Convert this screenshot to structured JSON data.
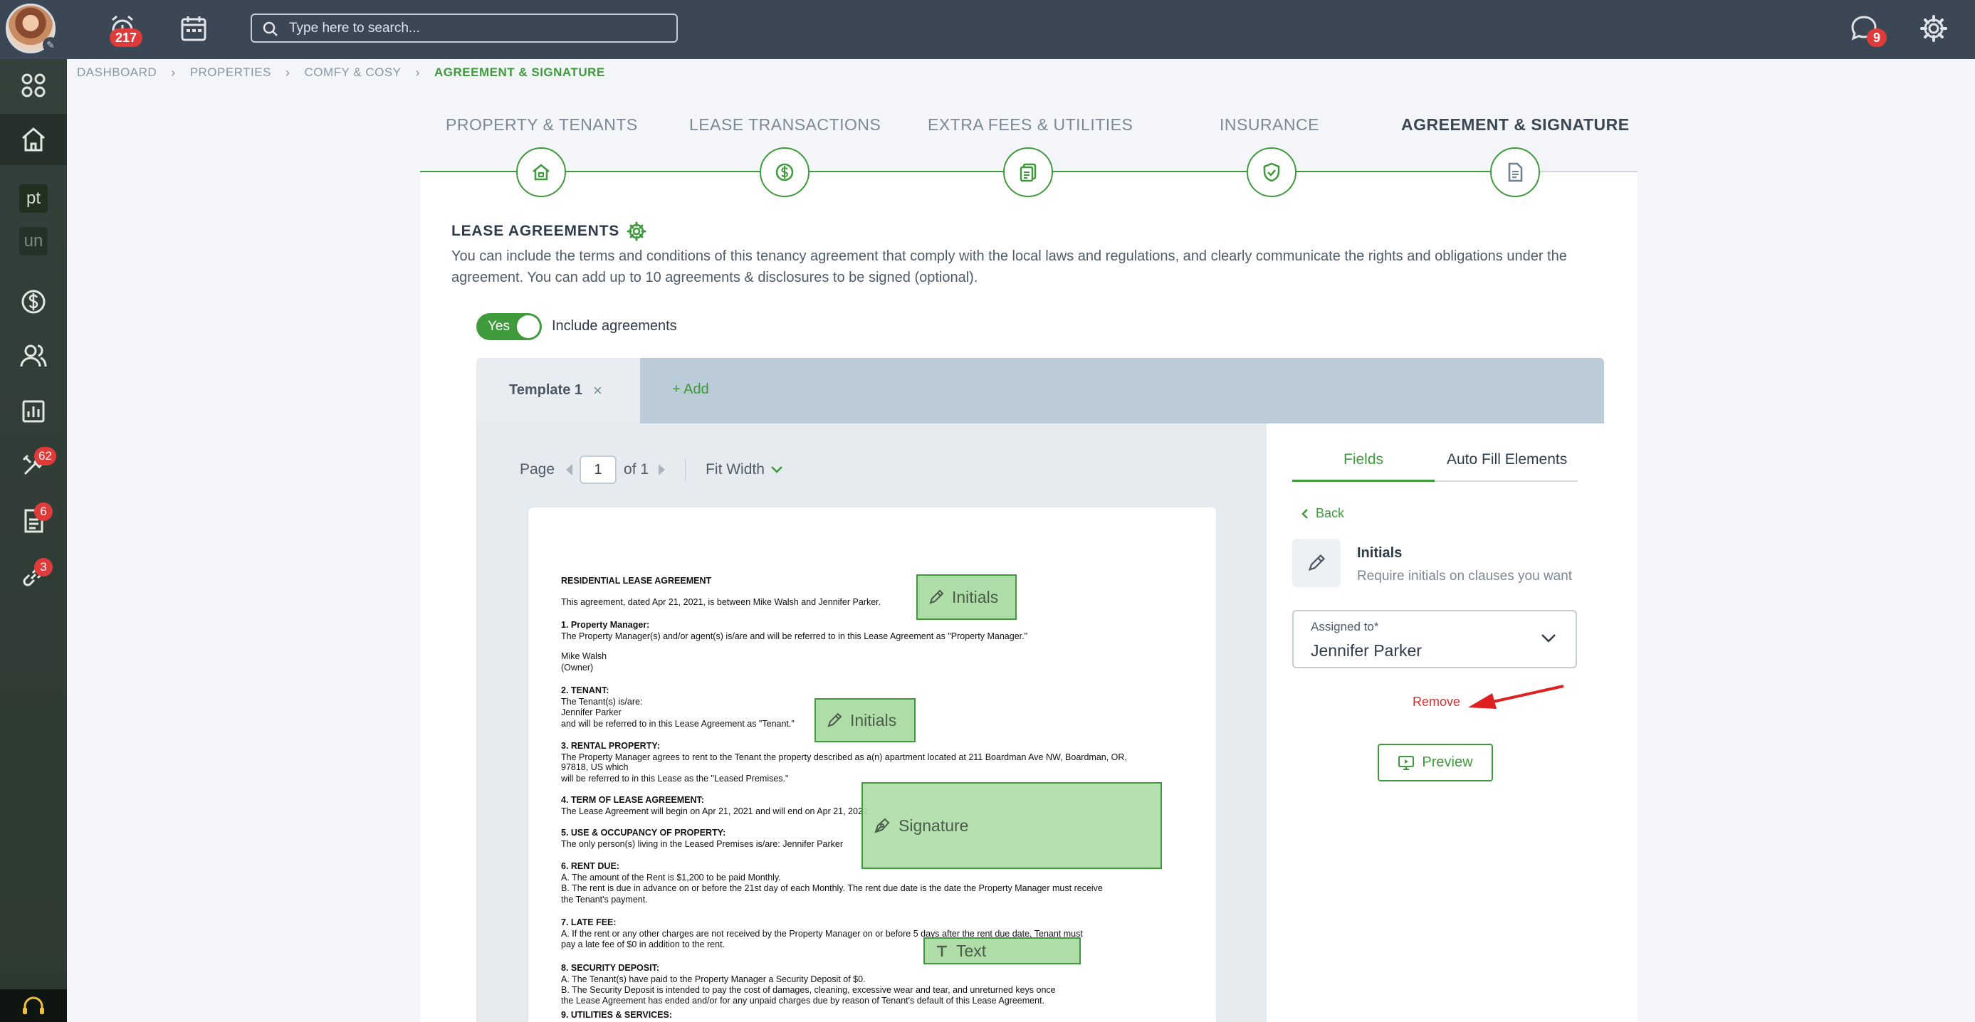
{
  "topbar": {
    "notifications_count": "217",
    "search_placeholder": "Type here to search...",
    "messages_count": "9"
  },
  "sidebar": {
    "items": [
      {
        "icon": "apps-grid-icon"
      },
      {
        "icon": "home-icon"
      },
      {
        "text": "pt"
      },
      {
        "text": "un"
      },
      {
        "icon": "dollar-circle-icon"
      },
      {
        "icon": "people-icon"
      },
      {
        "icon": "reports-chart-icon"
      },
      {
        "icon": "tools-icon",
        "badge": "62"
      },
      {
        "icon": "document-icon",
        "badge": "6"
      },
      {
        "icon": "link-icon",
        "badge": "3"
      }
    ]
  },
  "breadcrumb": [
    "DASHBOARD",
    "PROPERTIES",
    "COMFY & COSY",
    "AGREEMENT & SIGNATURE"
  ],
  "steps": [
    {
      "label": "PROPERTY & TENANTS",
      "icon": "home-icon"
    },
    {
      "label": "LEASE TRANSACTIONS",
      "icon": "dollar-icon"
    },
    {
      "label": "EXTRA FEES & UTILITIES",
      "icon": "bills-icon"
    },
    {
      "label": "INSURANCE",
      "icon": "shield-icon"
    },
    {
      "label": "AGREEMENT & SIGNATURE",
      "icon": "document-icon"
    }
  ],
  "section": {
    "title": "LEASE AGREEMENTS",
    "description": "You can include the terms and conditions of this tenancy agreement that comply with the local laws and regulations, and clearly communicate the rights and obligations under the agreement. You can add up to 10 agreements & disclosures to be signed (optional)."
  },
  "toggle": {
    "value": "Yes",
    "label": "Include agreements"
  },
  "templates": {
    "active": "Template 1",
    "close": "×",
    "add": "+ Add"
  },
  "viewer": {
    "page_label": "Page",
    "page_value": "1",
    "page_of": "of 1",
    "zoom": "Fit Width"
  },
  "document": {
    "lines": [
      {
        "text": "RESIDENTIAL LEASE AGREEMENT",
        "bold": true
      },
      {
        "text": "This agreement, dated Apr 21, 2021, is between Mike Walsh and Jennifer Parker.",
        "bold": false
      },
      {
        "text": "1. Property Manager:",
        "bold": true
      },
      {
        "text": "The Property Manager(s) and/or agent(s) is/are and will be referred to in this Lease Agreement as \"Property Manager.\"",
        "bold": false
      },
      {
        "text": "Mike Walsh",
        "bold": false
      },
      {
        "text": "(Owner)",
        "bold": false
      },
      {
        "text": "2. TENANT:",
        "bold": true
      },
      {
        "text": "The Tenant(s) is/are:",
        "bold": false
      },
      {
        "text": "Jennifer Parker",
        "bold": false
      },
      {
        "text": "and will be referred to in this Lease Agreement as \"Tenant.\"",
        "bold": false
      },
      {
        "text": "3. RENTAL PROPERTY:",
        "bold": true
      },
      {
        "text": "The Property Manager agrees to rent to the Tenant the property described as a(n) apartment located at  211 Boardman Ave NW, Boardman, OR,",
        "bold": false
      },
      {
        "text": "97818, US which",
        "bold": false
      },
      {
        "text": "will be referred to in this Lease as the \"Leased Premises.\"",
        "bold": false
      },
      {
        "text": "4. TERM OF LEASE AGREEMENT:",
        "bold": true
      },
      {
        "text": "The Lease Agreement will begin on Apr 21, 2021 and will end on Apr 21, 2022.",
        "bold": false
      },
      {
        "text": "5. USE & OCCUPANCY OF PROPERTY:",
        "bold": true
      },
      {
        "text": "The only person(s) living in the Leased Premises is/are: Jennifer Parker",
        "bold": false
      },
      {
        "text": "6. RENT DUE:",
        "bold": true
      },
      {
        "text": "A. The amount of the Rent is $1,200 to be paid Monthly.",
        "bold": false
      },
      {
        "text": "B. The rent is due in advance on or before the 21st day of each Monthly. The rent due date is the date the Property Manager must receive",
        "bold": false
      },
      {
        "text": "the Tenant's payment.",
        "bold": false
      },
      {
        "text": "7. LATE FEE:",
        "bold": true
      },
      {
        "text": "A. If the rent or any other charges are not received by the Property Manager on or before 5 days after the rent due date, Tenant must",
        "bold": false
      },
      {
        "text": "pay a late fee of $0 in addition to the rent.",
        "bold": false
      },
      {
        "text": "8. SECURITY DEPOSIT:",
        "bold": true
      },
      {
        "text": "A. The Tenant(s) have paid to the Property Manager a Security Deposit of $0.",
        "bold": false
      },
      {
        "text": "B. The Security Deposit is intended to pay the cost of damages, cleaning, excessive wear and tear, and unreturned keys once",
        "bold": false
      },
      {
        "text": "the Lease Agreement has ended and/or for any unpaid charges due by reason of Tenant's default of this Lease Agreement.",
        "bold": false
      },
      {
        "text": "9. UTILITIES & SERVICES:",
        "bold": true
      }
    ],
    "fields": [
      {
        "label": "Initials",
        "icon": "pencil-icon"
      },
      {
        "label": "Initials",
        "icon": "pencil-icon"
      },
      {
        "label": "Signature",
        "icon": "pen-nib-icon"
      },
      {
        "label": "Text",
        "icon": "text-icon"
      }
    ]
  },
  "panel": {
    "tabs": [
      "Fields",
      "Auto Fill Elements"
    ],
    "back": "Back",
    "field_title": "Initials",
    "field_subtitle": "Require initials on clauses you want",
    "assigned_label": "Assigned to*",
    "assigned_value": "Jennifer Parker",
    "remove": "Remove",
    "preview": "Preview"
  },
  "colors": {
    "accent": "#3f9a3c",
    "topbar": "#3b4755",
    "danger": "#d03232",
    "field_fill": "#afdda8"
  }
}
